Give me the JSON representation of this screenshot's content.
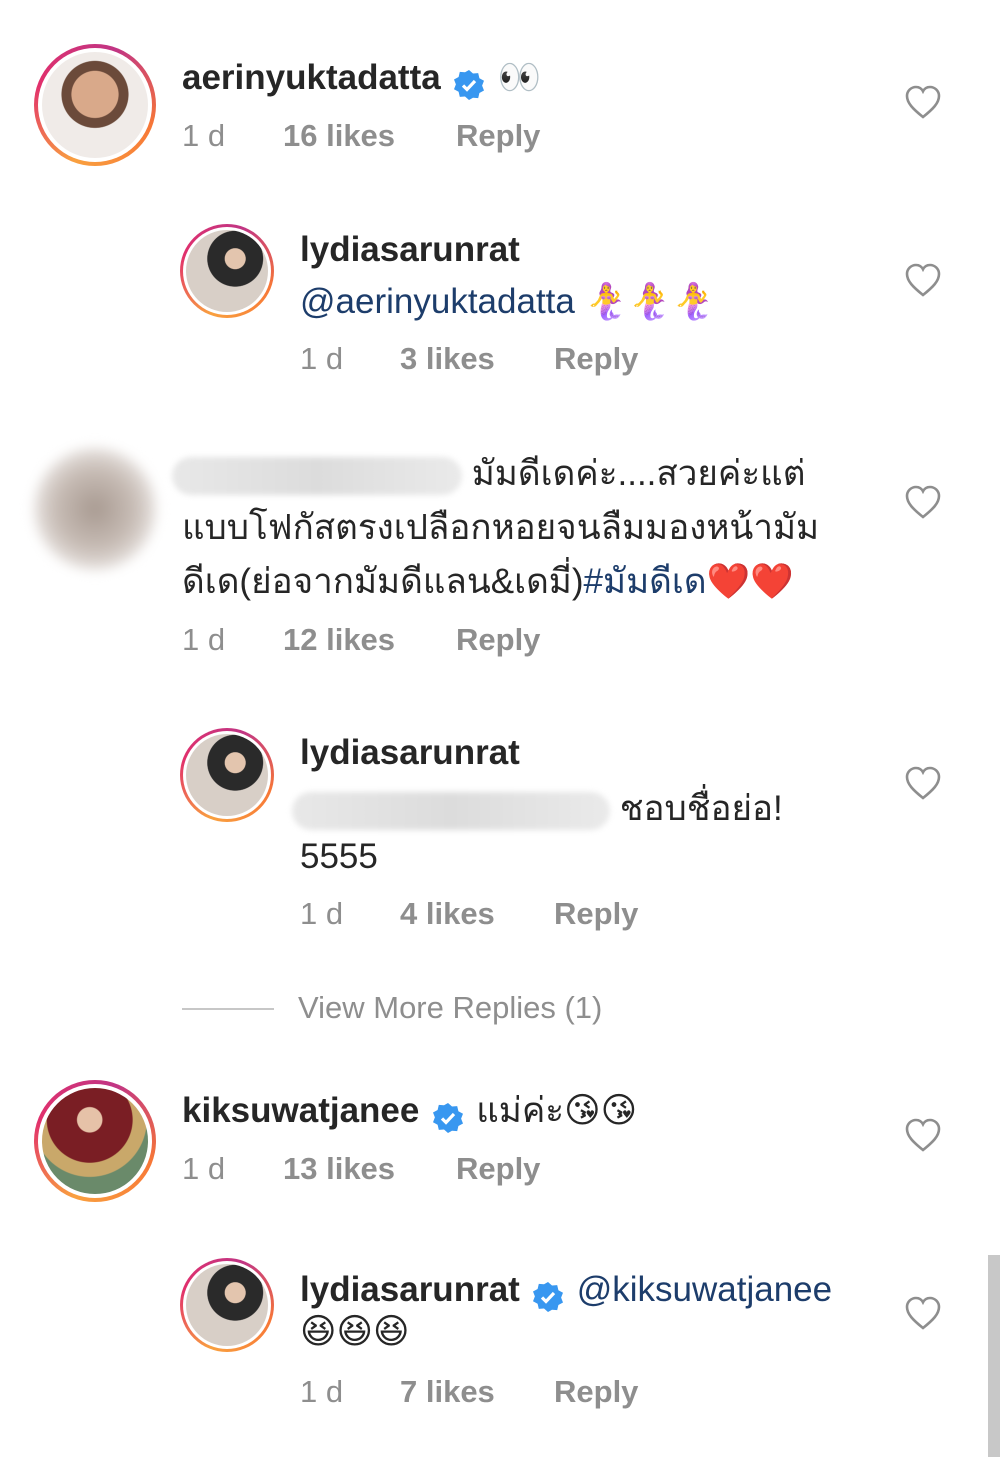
{
  "comments": [
    {
      "username": "aerinyuktadatta",
      "verified": true,
      "text": "👀",
      "time": "1 d",
      "likes": "16 likes",
      "reply": "Reply"
    },
    {
      "username": "lydiasarunrat",
      "verified": false,
      "mention": "@aerinyuktadatta",
      "text": "🧜‍♀️🧜‍♀️🧜‍♀️",
      "time": "1 d",
      "likes": "3 likes",
      "reply": "Reply"
    },
    {
      "username": "",
      "line1": "มัมดีเดค่ะ....สวยค่ะแต่",
      "line2": "แบบโฟกัสตรงเปลือกหอยจนลืมมองหน้ามัม",
      "line3": "ดีเด(ย่อจากมัมดีแลน&เดมี่)",
      "hashtag": "#มัมดีเด",
      "hearts": "❤️❤️",
      "time": "1 d",
      "likes": "12 likes",
      "reply": "Reply"
    },
    {
      "username": "lydiasarunrat",
      "line1": "ชอบชื่อย่อ!",
      "line2": "5555",
      "time": "1 d",
      "likes": "4 likes",
      "reply": "Reply"
    },
    {
      "username": "kiksuwatjanee",
      "verified": true,
      "text": "แม่ค่ะ😘😘",
      "time": "1 d",
      "likes": "13 likes",
      "reply": "Reply"
    },
    {
      "username": "lydiasarunrat",
      "verified": true,
      "mention": "@kiksuwatjanee",
      "text": "😆😆😆",
      "time": "1 d",
      "likes": "7 likes",
      "reply": "Reply"
    }
  ],
  "view_more_replies": "View More Replies (1)"
}
